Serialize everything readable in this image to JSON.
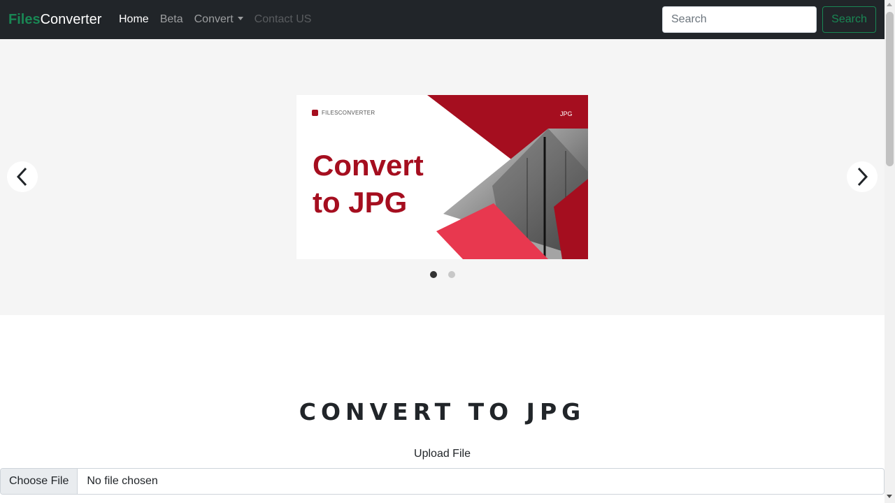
{
  "navbar": {
    "brand_part1": "Files",
    "brand_part2": "Converter",
    "links": [
      {
        "label": "Home",
        "state": "active"
      },
      {
        "label": "Beta",
        "state": "normal"
      },
      {
        "label": "Convert",
        "state": "dropdown"
      },
      {
        "label": "Contact US",
        "state": "disabled"
      }
    ],
    "search_placeholder": "Search",
    "search_button": "Search"
  },
  "carousel": {
    "slide": {
      "logo_text": "FILESCONVERTER",
      "tag": "JPG",
      "heading_line1": "Convert",
      "heading_line2": "to JPG"
    },
    "active_index": 0,
    "slide_count": 2
  },
  "main": {
    "title": "CONVERT TO JPG",
    "upload_label": "Upload File",
    "file_button": "Choose File",
    "file_status": "No file chosen"
  },
  "colors": {
    "brand_green": "#198754",
    "navbar_bg": "#212529",
    "accent_red": "#a50e1f",
    "accent_pink": "#e8384f"
  }
}
